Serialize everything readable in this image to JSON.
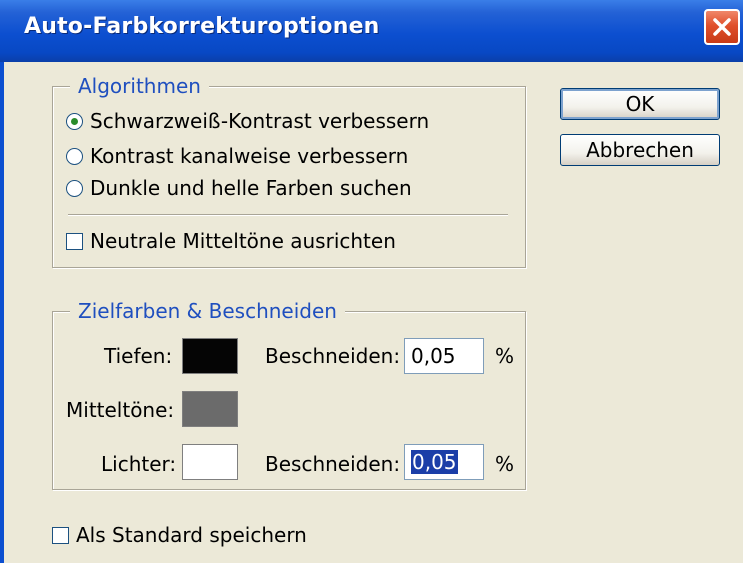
{
  "window": {
    "title": "Auto-Farbkorrekturoptionen",
    "close_icon": "close-icon",
    "accent_color": "#0c4fd0"
  },
  "algorithms": {
    "legend": "Algorithmen",
    "options": [
      {
        "label": "Schwarzweiß-Kontrast verbessern",
        "selected": true
      },
      {
        "label": "Kontrast kanalweise verbessern",
        "selected": false
      },
      {
        "label": "Dunkle und helle Farben suchen",
        "selected": false
      }
    ],
    "snap_neutral": {
      "label": "Neutrale Mitteltöne ausrichten",
      "checked": false
    }
  },
  "targets": {
    "legend": "Zielfarben & Beschneiden",
    "shadows": {
      "label": "Tiefen:",
      "color": "#050505",
      "clip_label": "Beschneiden:",
      "clip_value": "0,05",
      "unit": "%"
    },
    "midtones": {
      "label": "Mitteltöne:",
      "color": "#6b6b6b"
    },
    "highlights": {
      "label": "Lichter:",
      "color": "#ffffff",
      "clip_label": "Beschneiden:",
      "clip_value": "0,05",
      "unit": "%"
    }
  },
  "save_default": {
    "label": "Als Standard speichern",
    "checked": false
  },
  "buttons": {
    "ok": "OK",
    "cancel": "Abbrechen"
  }
}
